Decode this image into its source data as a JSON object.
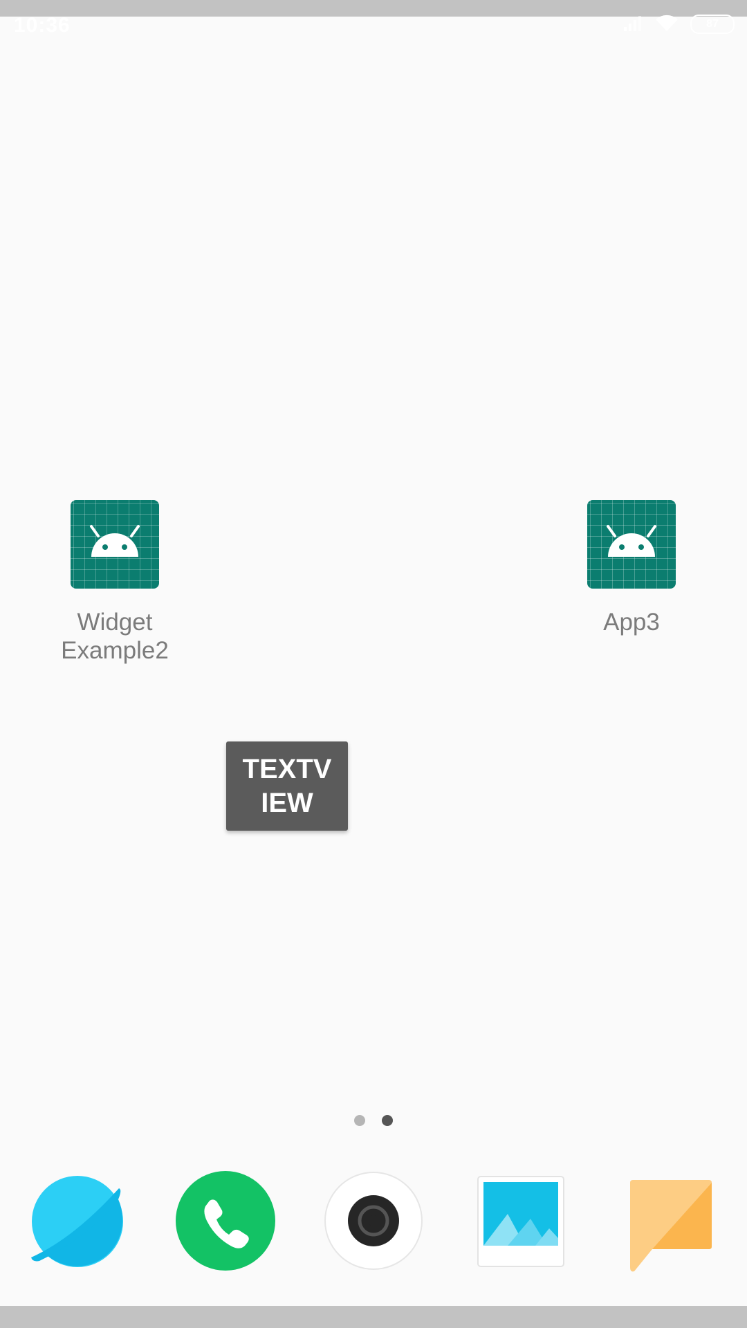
{
  "status_bar": {
    "time": "10:36",
    "battery_level": "87"
  },
  "home_screen": {
    "apps": [
      {
        "label": "Widget\nExample2",
        "icon": "android-app-icon"
      },
      {
        "label": "App3",
        "icon": "android-app-icon"
      }
    ],
    "textview_widget": {
      "text": "TEXTV\nIEW"
    },
    "page_indicator": {
      "pages": 2,
      "current_page": 2
    }
  },
  "dock": [
    {
      "app": "browser",
      "icon": "browser-planet-icon"
    },
    {
      "app": "phone",
      "icon": "phone-icon"
    },
    {
      "app": "camera",
      "icon": "camera-icon"
    },
    {
      "app": "gallery",
      "icon": "gallery-icon"
    },
    {
      "app": "messaging",
      "icon": "message-bubble-icon"
    }
  ],
  "colors": {
    "background": "#fafafa",
    "app_tile": "#0b7d6f",
    "widget_bg": "#5b5b5b",
    "browser": "#19c0ee",
    "phone": "#13c265",
    "message": "#fcbf5a"
  }
}
